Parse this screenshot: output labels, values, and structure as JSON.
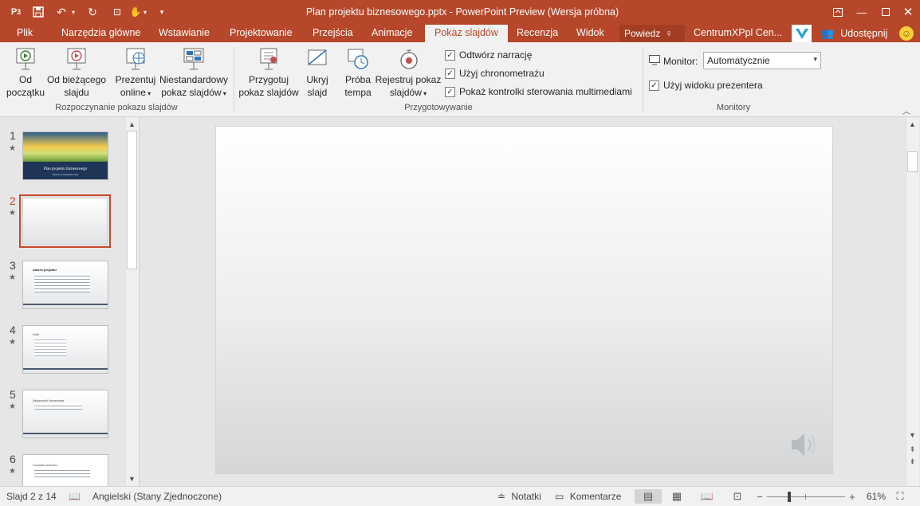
{
  "title": "Plan projektu biznesowego.pptx - PowerPoint Preview (Wersja próbna)",
  "tabs": [
    "Plik",
    "Narzędzia główne",
    "Wstawianie",
    "Projektowanie",
    "Przejścia",
    "Animacje",
    "Pokaz slajdów",
    "Recenzja",
    "Widok"
  ],
  "tell_me": "Powiedz",
  "account": "CentrumXPpl Cen...",
  "share": "Udostępnij",
  "ribbon": {
    "from_start": [
      "Od",
      "początku"
    ],
    "from_current": [
      "Od bieżącego",
      "slajdu"
    ],
    "present_online": [
      "Prezentuj",
      "online"
    ],
    "custom_show": [
      "Niestandardowy",
      "pokaz slajdów"
    ],
    "group_start": "Rozpoczynanie pokazu slajdów",
    "setup_show": [
      "Przygotuj",
      "pokaz slajdów"
    ],
    "hide_slide": [
      "Ukryj",
      "slajd"
    ],
    "rehearse": [
      "Próba",
      "tempa"
    ],
    "record": [
      "Rejestruj pokaz",
      "slajdów"
    ],
    "play_narrations": "Odtwórz narrację",
    "use_timings": "Użyj chronometrażu",
    "show_media_controls": "Pokaż kontrolki sterowania multimediami",
    "group_setup": "Przygotowywanie",
    "monitor_label": "Monitor:",
    "monitor_value": "Automatycznie",
    "presenter_view": "Użyj widoku prezentera",
    "group_monitors": "Monitory"
  },
  "thumbnails": [
    {
      "num": "1",
      "title": "Plan projektu biznesowego",
      "subtitle": "Nazwa przedsiębiorstwa"
    },
    {
      "num": "2",
      "title": "",
      "subtitle": ""
    },
    {
      "num": "3",
      "title": "Zakres projektu",
      "lines": 5
    },
    {
      "num": "4",
      "title": "Cele",
      "lines": 5
    },
    {
      "num": "5",
      "title": "Aktywność biznesowa",
      "lines": 2
    },
    {
      "num": "6",
      "title": "Czynniki sukcesu",
      "lines": 3
    }
  ],
  "status": {
    "slide": "Slajd 2 z 14",
    "language": "Angielski (Stany Zjednoczone)",
    "notes": "Notatki",
    "comments": "Komentarze",
    "zoom": "61%"
  },
  "colors": {
    "accent": "#b7472a",
    "ribbon": "#f1f1f1"
  }
}
